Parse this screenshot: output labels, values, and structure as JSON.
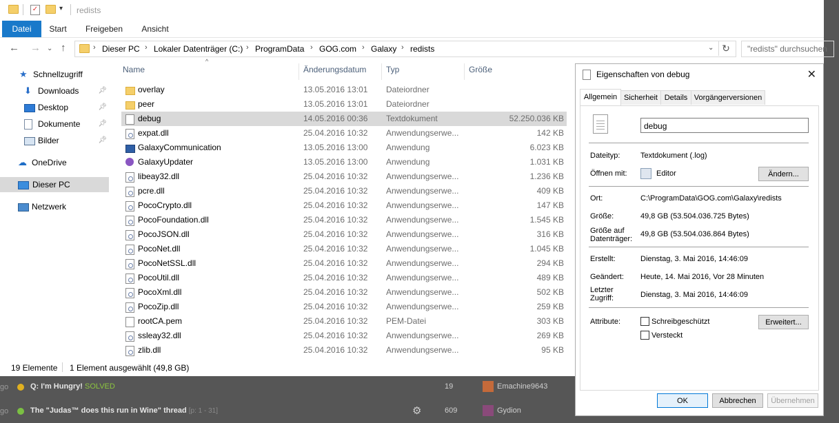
{
  "window": {
    "title": "redists",
    "ribbon_tabs": [
      "Datei",
      "Start",
      "Freigeben",
      "Ansicht"
    ]
  },
  "address": {
    "crumbs": [
      "Dieser PC",
      "Lokaler Datenträger (C:)",
      "ProgramData",
      "GOG.com",
      "Galaxy",
      "redists"
    ],
    "search_placeholder": "\"redists\" durchsuchen"
  },
  "nav": {
    "items": [
      {
        "label": "Schnellzugriff",
        "icon": "star-icon"
      },
      {
        "label": "Downloads",
        "icon": "download-icon",
        "pinned": true
      },
      {
        "label": "Desktop",
        "icon": "desktop-icon",
        "pinned": true
      },
      {
        "label": "Dokumente",
        "icon": "documents-icon",
        "pinned": true
      },
      {
        "label": "Bilder",
        "icon": "pictures-icon",
        "pinned": true
      },
      {
        "label": "OneDrive",
        "icon": "cloud-icon"
      },
      {
        "label": "Dieser PC",
        "icon": "computer-icon",
        "selected": true
      },
      {
        "label": "Netzwerk",
        "icon": "network-icon"
      }
    ]
  },
  "columns": {
    "name": "Name",
    "date": "Änderungsdatum",
    "type": "Typ",
    "size": "Größe"
  },
  "files": [
    {
      "name": "overlay",
      "date": "13.05.2016 13:01",
      "type": "Dateiordner",
      "size": "",
      "icon": "folder"
    },
    {
      "name": "peer",
      "date": "13.05.2016 13:01",
      "type": "Dateiordner",
      "size": "",
      "icon": "folder"
    },
    {
      "name": "debug",
      "date": "14.05.2016 00:36",
      "type": "Textdokument",
      "size": "52.250.036 KB",
      "icon": "doc",
      "selected": true
    },
    {
      "name": "expat.dll",
      "date": "25.04.2016 10:32",
      "type": "Anwendungserwe...",
      "size": "142 KB",
      "icon": "dll"
    },
    {
      "name": "GalaxyCommunication",
      "date": "13.05.2016 13:00",
      "type": "Anwendung",
      "size": "6.023 KB",
      "icon": "app"
    },
    {
      "name": "GalaxyUpdater",
      "date": "13.05.2016 13:00",
      "type": "Anwendung",
      "size": "1.031 KB",
      "icon": "upd"
    },
    {
      "name": "libeay32.dll",
      "date": "25.04.2016 10:32",
      "type": "Anwendungserwe...",
      "size": "1.236 KB",
      "icon": "dll"
    },
    {
      "name": "pcre.dll",
      "date": "25.04.2016 10:32",
      "type": "Anwendungserwe...",
      "size": "409 KB",
      "icon": "dll"
    },
    {
      "name": "PocoCrypto.dll",
      "date": "25.04.2016 10:32",
      "type": "Anwendungserwe...",
      "size": "147 KB",
      "icon": "dll"
    },
    {
      "name": "PocoFoundation.dll",
      "date": "25.04.2016 10:32",
      "type": "Anwendungserwe...",
      "size": "1.545 KB",
      "icon": "dll"
    },
    {
      "name": "PocoJSON.dll",
      "date": "25.04.2016 10:32",
      "type": "Anwendungserwe...",
      "size": "316 KB",
      "icon": "dll"
    },
    {
      "name": "PocoNet.dll",
      "date": "25.04.2016 10:32",
      "type": "Anwendungserwe...",
      "size": "1.045 KB",
      "icon": "dll"
    },
    {
      "name": "PocoNetSSL.dll",
      "date": "25.04.2016 10:32",
      "type": "Anwendungserwe...",
      "size": "294 KB",
      "icon": "dll"
    },
    {
      "name": "PocoUtil.dll",
      "date": "25.04.2016 10:32",
      "type": "Anwendungserwe...",
      "size": "489 KB",
      "icon": "dll"
    },
    {
      "name": "PocoXml.dll",
      "date": "25.04.2016 10:32",
      "type": "Anwendungserwe...",
      "size": "502 KB",
      "icon": "dll"
    },
    {
      "name": "PocoZip.dll",
      "date": "25.04.2016 10:32",
      "type": "Anwendungserwe...",
      "size": "259 KB",
      "icon": "dll"
    },
    {
      "name": "rootCA.pem",
      "date": "25.04.2016 10:32",
      "type": "PEM-Datei",
      "size": "303 KB",
      "icon": "doc"
    },
    {
      "name": "ssleay32.dll",
      "date": "25.04.2016 10:32",
      "type": "Anwendungserwe...",
      "size": "269 KB",
      "icon": "dll"
    },
    {
      "name": "zlib.dll",
      "date": "25.04.2016 10:32",
      "type": "Anwendungserwe...",
      "size": "95 KB",
      "icon": "dll"
    }
  ],
  "status": {
    "count": "19 Elemente",
    "selection": "1 Element ausgewählt (49,8 GB)"
  },
  "forum": [
    {
      "prefix": "go",
      "title": "Q: I'm Hungry!",
      "tag": "SOLVED",
      "count": "19",
      "user": "Emachine9643",
      "dot": "#e0b020"
    },
    {
      "prefix": "go",
      "title": "The \"Judas™ does this run in Wine\" thread",
      "pages": "[p: 1 - 31]",
      "count": "609",
      "user": "Gydion",
      "dot": "#7bc043"
    }
  ],
  "props": {
    "title": "Eigenschaften von debug",
    "tabs": [
      "Allgemein",
      "Sicherheit",
      "Details",
      "Vorgängerversionen"
    ],
    "filename": "debug",
    "filetype_label": "Dateityp:",
    "filetype": "Textdokument (.log)",
    "openwith_label": "Öffnen mit:",
    "openwith": "Editor",
    "change_btn": "Ändern...",
    "location_label": "Ort:",
    "location": "C:\\ProgramData\\GOG.com\\Galaxy\\redists",
    "size_label": "Größe:",
    "size": "49,8 GB (53.504.036.725 Bytes)",
    "disksize_label_1": "Größe auf",
    "disksize_label_2": "Datenträger:",
    "disksize": "49,8 GB (53.504.036.864 Bytes)",
    "created_label": "Erstellt:",
    "created": "Dienstag, 3. Mai 2016, 14:46:09",
    "modified_label": "Geändert:",
    "modified": "Heute, 14. Mai 2016, Vor 28 Minuten",
    "accessed_label_1": "Letzter",
    "accessed_label_2": "Zugriff:",
    "accessed": "Dienstag, 3. Mai 2016, 14:46:09",
    "attributes_label": "Attribute:",
    "readonly": "Schreibgeschützt",
    "hidden": "Versteckt",
    "advanced_btn": "Erweitert...",
    "ok": "OK",
    "cancel": "Abbrechen",
    "apply": "Übernehmen"
  }
}
